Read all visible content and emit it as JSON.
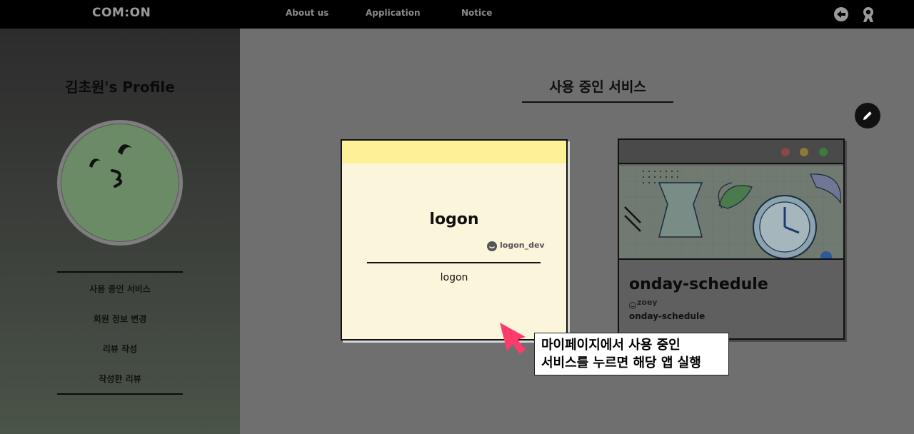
{
  "nav": {
    "logo": "COM:ON",
    "links": [
      "About us",
      "Application",
      "Notice"
    ],
    "icons": [
      "back-arrow-icon",
      "user-icon"
    ]
  },
  "sidebar": {
    "profile_title": "김초원's Profile",
    "menu": [
      "사용 중인 서비스",
      "회원 정보 변경",
      "리뷰 작성",
      "작성한 리뷰"
    ]
  },
  "main": {
    "section_title": "사용 중인 서비스",
    "edit_icon": "pencil-icon",
    "cards": [
      {
        "name": "logon",
        "author": "logon_dev",
        "description": "logon"
      },
      {
        "name": "onday-schedule",
        "author": "zoey",
        "description": "onday-schedule"
      }
    ]
  },
  "annotation": {
    "line1": "마이페이지에서  사용  중인",
    "line2": "서비스를 누르면 해당 앱 실행"
  },
  "colors": {
    "nav_bg": "#000000",
    "main_bg": "#6f6f6f",
    "card_yellow": "#fdf198",
    "card_cream": "#fbf5dc",
    "arrow_pink": "#ff3b6b"
  }
}
